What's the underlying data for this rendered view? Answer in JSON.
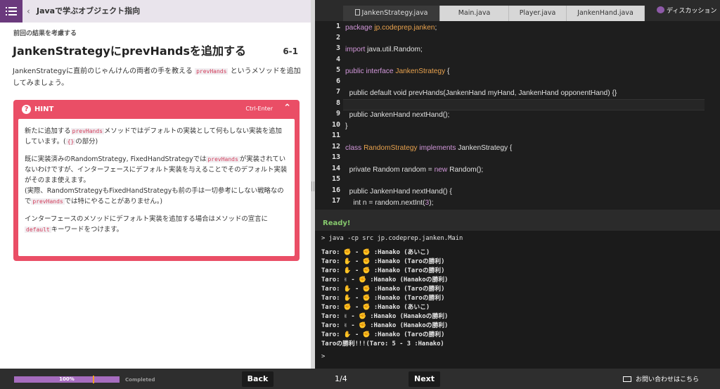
{
  "header": {
    "course_title": "Javaで学ぶオブジェクト指向"
  },
  "lesson": {
    "breadcrumb": "前回の結果を考慮する",
    "title": "JankenStrategyにprevHandsを追加する",
    "number": "6-1",
    "intro_pre": "JankenStrategyに直前のじゃんけんの両者の手を教える",
    "intro_code": "prevHands",
    "intro_post": "というメソッドを追加してみましょう。"
  },
  "hint": {
    "label": "HINT",
    "shortcut": "Ctrl-Enter",
    "p1_a": "新たに追加する",
    "p1_code": "prevHands",
    "p1_b": "メソッドではデフォルトの実装として何もしない実装を追加しています。(",
    "p1_code2": "{}",
    "p1_c": "の部分)",
    "p2_a": "既に実装済みのRandomStrategy, FixedHandStrategyでは",
    "p2_code": "prevHands",
    "p2_b": "が実装されていないわけですが、インターフェースにデフォルト実装を与えることでそのデフォルト実装がそのまま使えます。",
    "p2_c": "(実際、RandomStrategyもFixedHandStrategyも前の手は一切参考にしない戦略なので",
    "p2_code2": "prevHands",
    "p2_d": "では特にやることがありません。)",
    "p3_a": "インターフェースのメソッドにデフォルト実装を追加する場合はメソッドの宣言に",
    "p3_code": "default",
    "p3_b": "キーワードをつけます。"
  },
  "tabs": [
    {
      "label": "JankenStrategy.java"
    },
    {
      "label": "Main.java"
    },
    {
      "label": "Player.java"
    },
    {
      "label": "JankenHand.java"
    }
  ],
  "discussion_label": "ディスカッション",
  "editor": {
    "line_numbers": [
      "1",
      "2",
      "3",
      "4",
      "5",
      "6",
      "7",
      "8",
      "9",
      "10",
      "11",
      "12",
      "13",
      "14",
      "15",
      "16",
      "17"
    ],
    "l1_kw": "package",
    "l1_pkg": "jp.codeprep.janken",
    "l1_end": ";",
    "l3_kw": "import",
    "l3_rest": " java.util.Random;",
    "l5_kw": "public interface",
    "l5_ty": "JankenStrategy",
    "l5_end": " {",
    "l7": "  public default void prevHands(JankenHand myHand, JankenHand opponentHand) {}",
    "l9": "  public JankenHand nextHand();",
    "l10": "}",
    "l12_kw": "class",
    "l12_ty": "RandomStrategy",
    "l12_kw2": "implements",
    "l12_rest": " JankenStrategy {",
    "l14_a": "  private Random random = ",
    "l14_kw": "new",
    "l14_b": " Random();",
    "l16": "  public JankenHand nextHand() {",
    "l17_a": "    int n = random.nextInt(",
    "l17_num": "3",
    "l17_b": ");"
  },
  "status": "Ready!",
  "console": {
    "command": "> java -cp src jp.codeprep.janken.Main",
    "lines": [
      "Taro: ✊ - ✊ :Hanako (あいこ)",
      "Taro: ✋ - ✊ :Hanako (Taroの勝利)",
      "Taro: ✋ - ✊ :Hanako (Taroの勝利)",
      "Taro: ✌ - ✊ :Hanako (Hanakoの勝利)",
      "Taro: ✋ - ✊ :Hanako (Taroの勝利)",
      "Taro: ✋ - ✊ :Hanako (Taroの勝利)",
      "Taro: ✊ - ✊ :Hanako (あいこ)",
      "Taro: ✌ - ✊ :Hanako (Hanakoの勝利)",
      "Taro: ✌ - ✊ :Hanako (Hanakoの勝利)",
      "Taro: ✋ - ✊ :Hanako (Taroの勝利)",
      "Taroの勝利!!!(Taro: 5 - 3 :Hanako)"
    ],
    "prompt": ">"
  },
  "footer": {
    "progress_text": "100%",
    "progress_value": 100,
    "completed_label": "Completed",
    "back_label": "Back",
    "page_indicator": "1/4",
    "next_label": "Next",
    "contact_label": "お問い合わせはこちら"
  }
}
